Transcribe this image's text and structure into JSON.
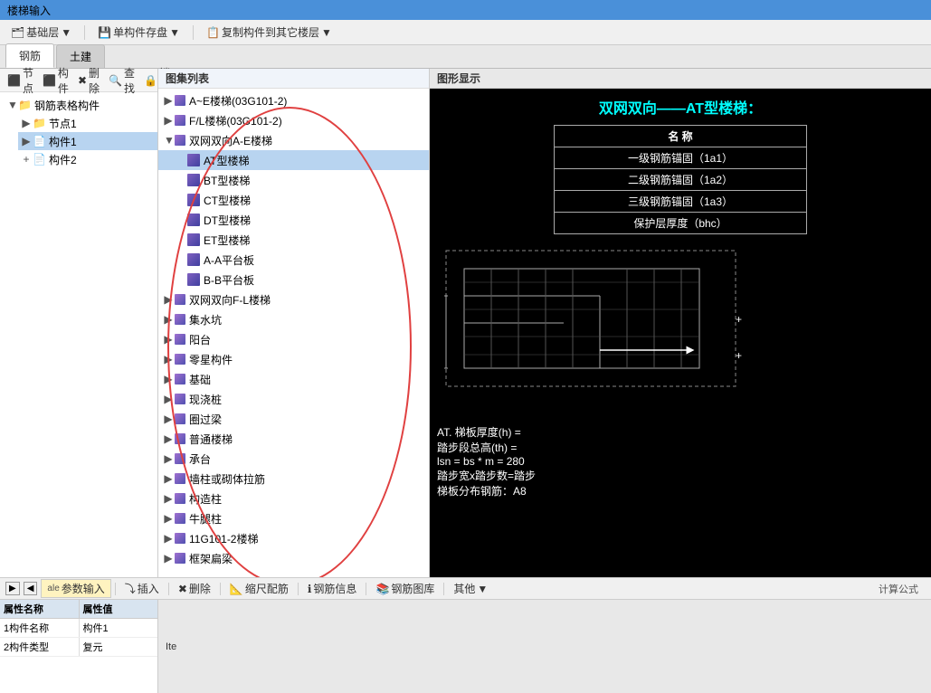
{
  "titlebar": {
    "text": "楼梯输入"
  },
  "toolbar": {
    "items": [
      {
        "label": "基础层",
        "hasDropdown": true
      },
      {
        "label": "单构件存盘",
        "hasDropdown": true
      },
      {
        "label": "复制构件到其它楼层",
        "hasDropdown": true
      }
    ]
  },
  "tabs": [
    {
      "label": "钢筋",
      "active": true
    },
    {
      "label": "土建",
      "active": false
    }
  ],
  "left_toolbar": {
    "buttons": [
      {
        "label": "节点",
        "icon": "⬛"
      },
      {
        "label": "构件",
        "icon": "⬛"
      },
      {
        "label": "删除",
        "icon": "✖"
      },
      {
        "label": "查找",
        "icon": "🔍"
      },
      {
        "label": "锁定",
        "icon": "🔒"
      }
    ]
  },
  "tree": {
    "root": {
      "label": "钢筋表格构件",
      "expanded": true,
      "children": [
        {
          "label": "节点1",
          "type": "folder",
          "expanded": false
        },
        {
          "label": "构件1",
          "type": "item",
          "selected": true,
          "expanded": false
        },
        {
          "label": "构件2",
          "type": "item",
          "expanded": false
        }
      ]
    }
  },
  "middle_panel": {
    "header": "图集列表",
    "groups": [
      {
        "label": "A~E楼梯(03G101-2)",
        "expanded": false
      },
      {
        "label": "F/L楼梯(03G101-2)",
        "expanded": false
      },
      {
        "label": "双网双向A-E楼梯",
        "expanded": true,
        "children": [
          {
            "label": "AT型楼梯",
            "selected": true
          },
          {
            "label": "BT型楼梯"
          },
          {
            "label": "CT型楼梯"
          },
          {
            "label": "DT型楼梯"
          },
          {
            "label": "ET型楼梯"
          },
          {
            "label": "A-A平台板"
          },
          {
            "label": "B-B平台板"
          }
        ]
      },
      {
        "label": "双网双向F-L楼梯",
        "expanded": false
      },
      {
        "label": "集水坑",
        "expanded": false
      },
      {
        "label": "阳台",
        "expanded": false
      },
      {
        "label": "零星构件",
        "expanded": false
      },
      {
        "label": "基础",
        "expanded": false
      },
      {
        "label": "现浇桩",
        "expanded": false
      },
      {
        "label": "圈过梁",
        "expanded": false
      },
      {
        "label": "普通楼梯",
        "expanded": false
      },
      {
        "label": "承台",
        "expanded": false
      },
      {
        "label": "墙柱或砌体拉筋",
        "expanded": false
      },
      {
        "label": "构造柱",
        "expanded": false
      },
      {
        "label": "牛腿柱",
        "expanded": false
      },
      {
        "label": "11G101-2楼梯",
        "expanded": false
      },
      {
        "label": "框架扁梁",
        "expanded": false
      }
    ]
  },
  "right_panel": {
    "header": "图形显示",
    "title": "双网双向——AT型楼梯：",
    "table": {
      "headers": [
        "名 称"
      ],
      "rows": [
        [
          "一级钢筋锚固（1a1）"
        ],
        [
          "二级钢筋锚固（1a2）"
        ],
        [
          "三级钢筋锚固（1a3）"
        ],
        [
          "保护层厚度（bhc）"
        ]
      ]
    },
    "diagram_texts": [
      "AT. 梯板厚度(h) =",
      "踏步段总高(th) =",
      "lsn = bs * m = 280",
      "踏步宽x踏步数=踏步",
      "梯板分布钢筋：A8"
    ]
  },
  "bottom_toolbar": {
    "buttons": [
      {
        "label": "参数输入",
        "icon": "ale",
        "active": true
      },
      {
        "label": "插入",
        "icon": "⤵"
      },
      {
        "label": "删除",
        "icon": "✖"
      },
      {
        "label": "缩尺配筋",
        "icon": "📐"
      },
      {
        "label": "钢筋信息",
        "icon": "ℹ"
      },
      {
        "label": "钢筋图库",
        "icon": "📚"
      },
      {
        "label": "其他",
        "icon": "•••",
        "hasDropdown": true
      }
    ]
  },
  "property_table": {
    "headers": [
      "属性名称",
      "属性值"
    ],
    "rows": [
      [
        "1构件名称",
        "构件1"
      ],
      [
        "2构件类型",
        "复元"
      ]
    ]
  },
  "calc_label": "计算公式",
  "bottom_label": "Ite"
}
